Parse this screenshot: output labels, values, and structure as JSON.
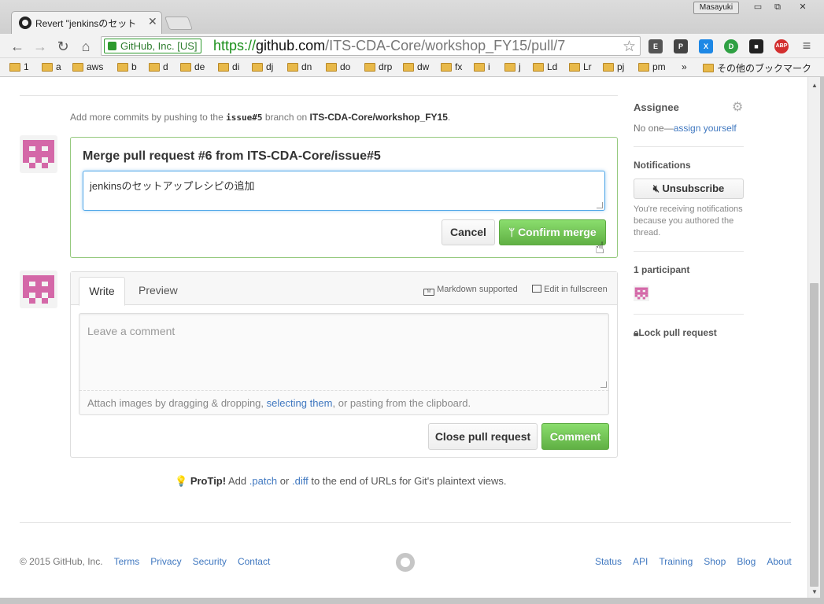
{
  "browser": {
    "tab_title": "Revert \"jenkinsのセット",
    "user_badge": "Masayuki",
    "ev_label": "GitHub, Inc. [US]",
    "url_scheme": "https://",
    "url_host": "github.com",
    "url_path": "/ITS-CDA-Core/workshop_FY15/pull/7",
    "extensions": [
      "E",
      "P",
      "X",
      "D",
      "■",
      "ABP"
    ],
    "bookmarks": [
      "1",
      "a",
      "aws",
      "b",
      "d",
      "de",
      "di",
      "dj",
      "dn",
      "do",
      "drp",
      "dw",
      "fx",
      "i",
      "j",
      "Ld",
      "Lr",
      "pj",
      "pm"
    ],
    "bookmarks_more": "»",
    "other_bookmarks": "その他のブックマーク"
  },
  "main": {
    "commits_hint_prefix": "Add more commits by pushing to the",
    "branch": "issue#5",
    "commits_hint_mid": "branch on",
    "repo": "ITS-CDA-Core/workshop_FY15",
    "commits_hint_end": ".",
    "merge": {
      "title": "Merge pull request #6 from ITS-CDA-Core/issue#5",
      "message": "jenkinsのセットアップレシピの追加",
      "cancel_label": "Cancel",
      "confirm_label": "Confirm merge"
    },
    "comment": {
      "tab_write": "Write",
      "tab_preview": "Preview",
      "markdown_label": "Markdown supported",
      "fullscreen_label": "Edit in fullscreen",
      "placeholder": "Leave a comment",
      "attach_prefix": "Attach images by dragging & dropping,",
      "attach_link": "selecting them",
      "attach_suffix": ", or pasting from the clipboard.",
      "close_label": "Close pull request",
      "comment_label": "Comment"
    },
    "protip": {
      "label": "ProTip!",
      "text1": "Add",
      "patch": ".patch",
      "text2": "or",
      "diff": ".diff",
      "text3": "to the end of URLs for Git's plaintext views."
    }
  },
  "sidebar": {
    "assignee_title": "Assignee",
    "assignee_none": "No one—",
    "assign_yourself": "assign yourself",
    "notifications_title": "Notifications",
    "unsubscribe_label": "Unsubscribe",
    "notifications_reason": "You're receiving notifications because you authored the thread.",
    "participants_title": "1 participant",
    "lock_label": "Lock pull request"
  },
  "footer": {
    "copyright": "© 2015 GitHub, Inc.",
    "left_links": [
      "Terms",
      "Privacy",
      "Security",
      "Contact"
    ],
    "right_links": [
      "Status",
      "API",
      "Training",
      "Shop",
      "Blog",
      "About"
    ]
  },
  "colors": {
    "link": "#4078c0",
    "green_button": "#60b044",
    "avatar_pink": "#d468a8"
  }
}
